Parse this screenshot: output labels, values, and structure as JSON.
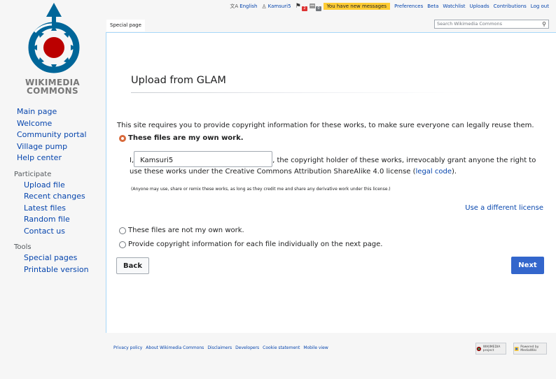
{
  "personal": {
    "language": "English",
    "username": "Kamsuri5",
    "notifications_alerts": "2",
    "notifications_notices": "0",
    "messages": "You have new messages",
    "links": [
      "Preferences",
      "Beta",
      "Watchlist",
      "Uploads",
      "Contributions",
      "Log out"
    ]
  },
  "logo": {
    "line1": "WIKIMEDIA",
    "line2": "COMMONS"
  },
  "sidebar": {
    "main": [
      "Main page",
      "Welcome",
      "Community portal",
      "Village pump",
      "Help center"
    ],
    "participate_heading": "Participate",
    "participate": [
      "Upload file",
      "Recent changes",
      "Latest files",
      "Random file",
      "Contact us"
    ],
    "tools_heading": "Tools",
    "tools": [
      "Special pages",
      "Printable version"
    ]
  },
  "tabs": {
    "special": "Special page"
  },
  "search": {
    "placeholder": "Search Wikimedia Commons"
  },
  "page": {
    "title": "Upload from GLAM",
    "intro": "This site requires you to provide copyright information for these works, to make sure everyone can legally reuse them.",
    "own_work_label": "These files are my own work.",
    "licence_prefix": "I,",
    "username_value": "Kamsuri5",
    "licence_mid": ", the copyright holder of these works, irrevocably grant anyone the right to use these works under the Creative Commons Attribution ShareAlike 4.0 license (",
    "legal_code": "legal code",
    "licence_suffix": ").",
    "fine_print": "(Anyone may use, share or remix these works, as long as they credit me and share any derivative work under this license.)",
    "different_license": "Use a different license",
    "not_own_label": "These files are not my own work.",
    "each_label": "Provide copyright information for each file individually on the next page.",
    "back": "Back",
    "next": "Next"
  },
  "footer": {
    "links": [
      "Privacy policy",
      "About Wikimedia Commons",
      "Disclaimers",
      "Developers",
      "Cookie statement",
      "Mobile view"
    ],
    "wikimedia_badge": "WIKIMEDIA project",
    "mediawiki_badge": "Powered by MediaWiki"
  },
  "colors": {
    "link": "#0645ad",
    "accent": "#3366cc",
    "radio_selected": "#d86a3c",
    "messages_bg": "#ffcc33"
  }
}
